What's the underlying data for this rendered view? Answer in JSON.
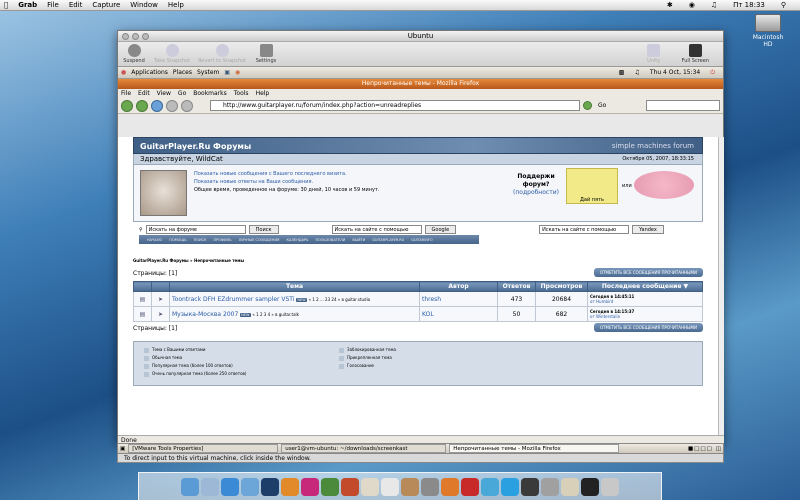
{
  "mac_menubar": {
    "app": "Grab",
    "items": [
      "File",
      "Edit",
      "Capture",
      "Window",
      "Help"
    ],
    "clock": "Пт 18:33"
  },
  "desktop": {
    "hd_label": "Macintosh HD"
  },
  "vm_window": {
    "title": "Ubuntu",
    "toolbar": [
      "Suspend",
      "Take Snapshot",
      "Revert to Snapshot",
      "Settings"
    ],
    "toolbar_right": [
      "Unity",
      "Full Screen"
    ]
  },
  "gnome_panel": {
    "menus": [
      "Applications",
      "Places",
      "System"
    ],
    "datetime": "Thu  4 Oct, 15:34"
  },
  "firefox": {
    "title": "Непрочитанные темы - Mozilla Firefox",
    "menus": [
      "File",
      "Edit",
      "View",
      "Go",
      "Bookmarks",
      "Tools",
      "Help"
    ],
    "url": "http://www.guitarplayer.ru/forum/index.php?action=unreadreplies",
    "go_label": "Go",
    "status": "Done"
  },
  "forum": {
    "banner_title": "GuitarPlayer.Ru Форумы",
    "smf": "simple machines forum",
    "greeting": "Здравствуйте, WildCat",
    "date": "Октября 05, 2007, 18:33:15",
    "links": [
      "Показать новые сообщения с Вашего последнего визита.",
      "Показать новые ответы на Ваши сообщения.",
      "Общее время, проведенное на форуме: 30 дней, 10 часов и 59 минут."
    ],
    "support_q": "Поддержи форум?",
    "support_more": "(подробности)",
    "donate_label": "Дай пять",
    "or_label": "или",
    "search": {
      "forum_placeholder": "Искать на форуме",
      "forum_btn": "Поиск",
      "google_placeholder": "Искать на сайте с помощью",
      "google_btn": "Google",
      "yandex_placeholder": "Искать на сайте с помощью",
      "yandex_btn": "Yandex"
    },
    "nav_tabs": [
      "НАЧАЛО",
      "ПОМОЩЬ",
      "ПОИСК",
      "ПРОФИЛЬ",
      "ЛИЧНЫЕ СООБЩЕНИЯ",
      "КАЛЕНДАРЬ",
      "ПОЛЬЗОВАТЕЛИ",
      "ВЫЙТИ",
      "GUITARPLAYER.RU",
      "GUITARINFO"
    ],
    "breadcrumb": "GuitarPlayer.Ru Форумы » Непрочитанные темы",
    "pages_label": "Страницы: [1]",
    "mark_read_btn": "ОТМЕТИТЬ ВСЕ СООБЩЕНИЯ ПРОЧИТАННЫМИ",
    "columns": [
      "Тема",
      "Автор",
      "Ответов",
      "Просмотров",
      "Последнее сообщение"
    ],
    "rows": [
      {
        "topic": "Toontrack DFH EZdrummer sampler VSTi",
        "badge": "NEW",
        "pages": "« 1 2 ... 23 24 » в guitar.studio",
        "author": "thresh",
        "replies": "473",
        "views": "20684",
        "last_date": "Сегодня в 14:45:11",
        "last_by": "от Humbird"
      },
      {
        "topic": "Музыка-Москва 2007",
        "badge": "NEW",
        "pages": "« 1 2 3 4 » в guitar.talk",
        "author": "KOL",
        "replies": "50",
        "views": "682",
        "last_date": "Сегодня в 14:15:37",
        "last_by": "от Winterstalin"
      }
    ],
    "legend": {
      "left": [
        "Тема с Вашими ответами",
        "Обычная тема",
        "Популярная тема (более 100 ответов)",
        "Очень популярная тема (более 250 ответов)"
      ],
      "right": [
        "Заблокированная тема",
        "Прикрепленная тема",
        "Голосование"
      ]
    }
  },
  "taskbar": {
    "items": [
      "[VMware Tools Properties]",
      "user1@vm-ubuntu: ~/downloads/screenkast",
      "Непрочитанные темы - Mozilla Firefox"
    ]
  },
  "vm_status": "To direct input to this virtual machine, click inside the window.",
  "dock_icons": [
    "finder-icon",
    "mail-icon",
    "safari-icon",
    "itunes-icon",
    "photoshop-icon",
    "illustrator-icon",
    "indesign-icon",
    "dreamweaver-icon",
    "fireworks-icon",
    "textedit-icon",
    "ical-icon",
    "addressbook-icon",
    "vmware-icon",
    "firefox-icon",
    "opera-icon",
    "chat-icon",
    "skype-icon",
    "activity-icon",
    "grab-icon",
    "preview-icon",
    "terminal-icon",
    "trash-icon"
  ]
}
